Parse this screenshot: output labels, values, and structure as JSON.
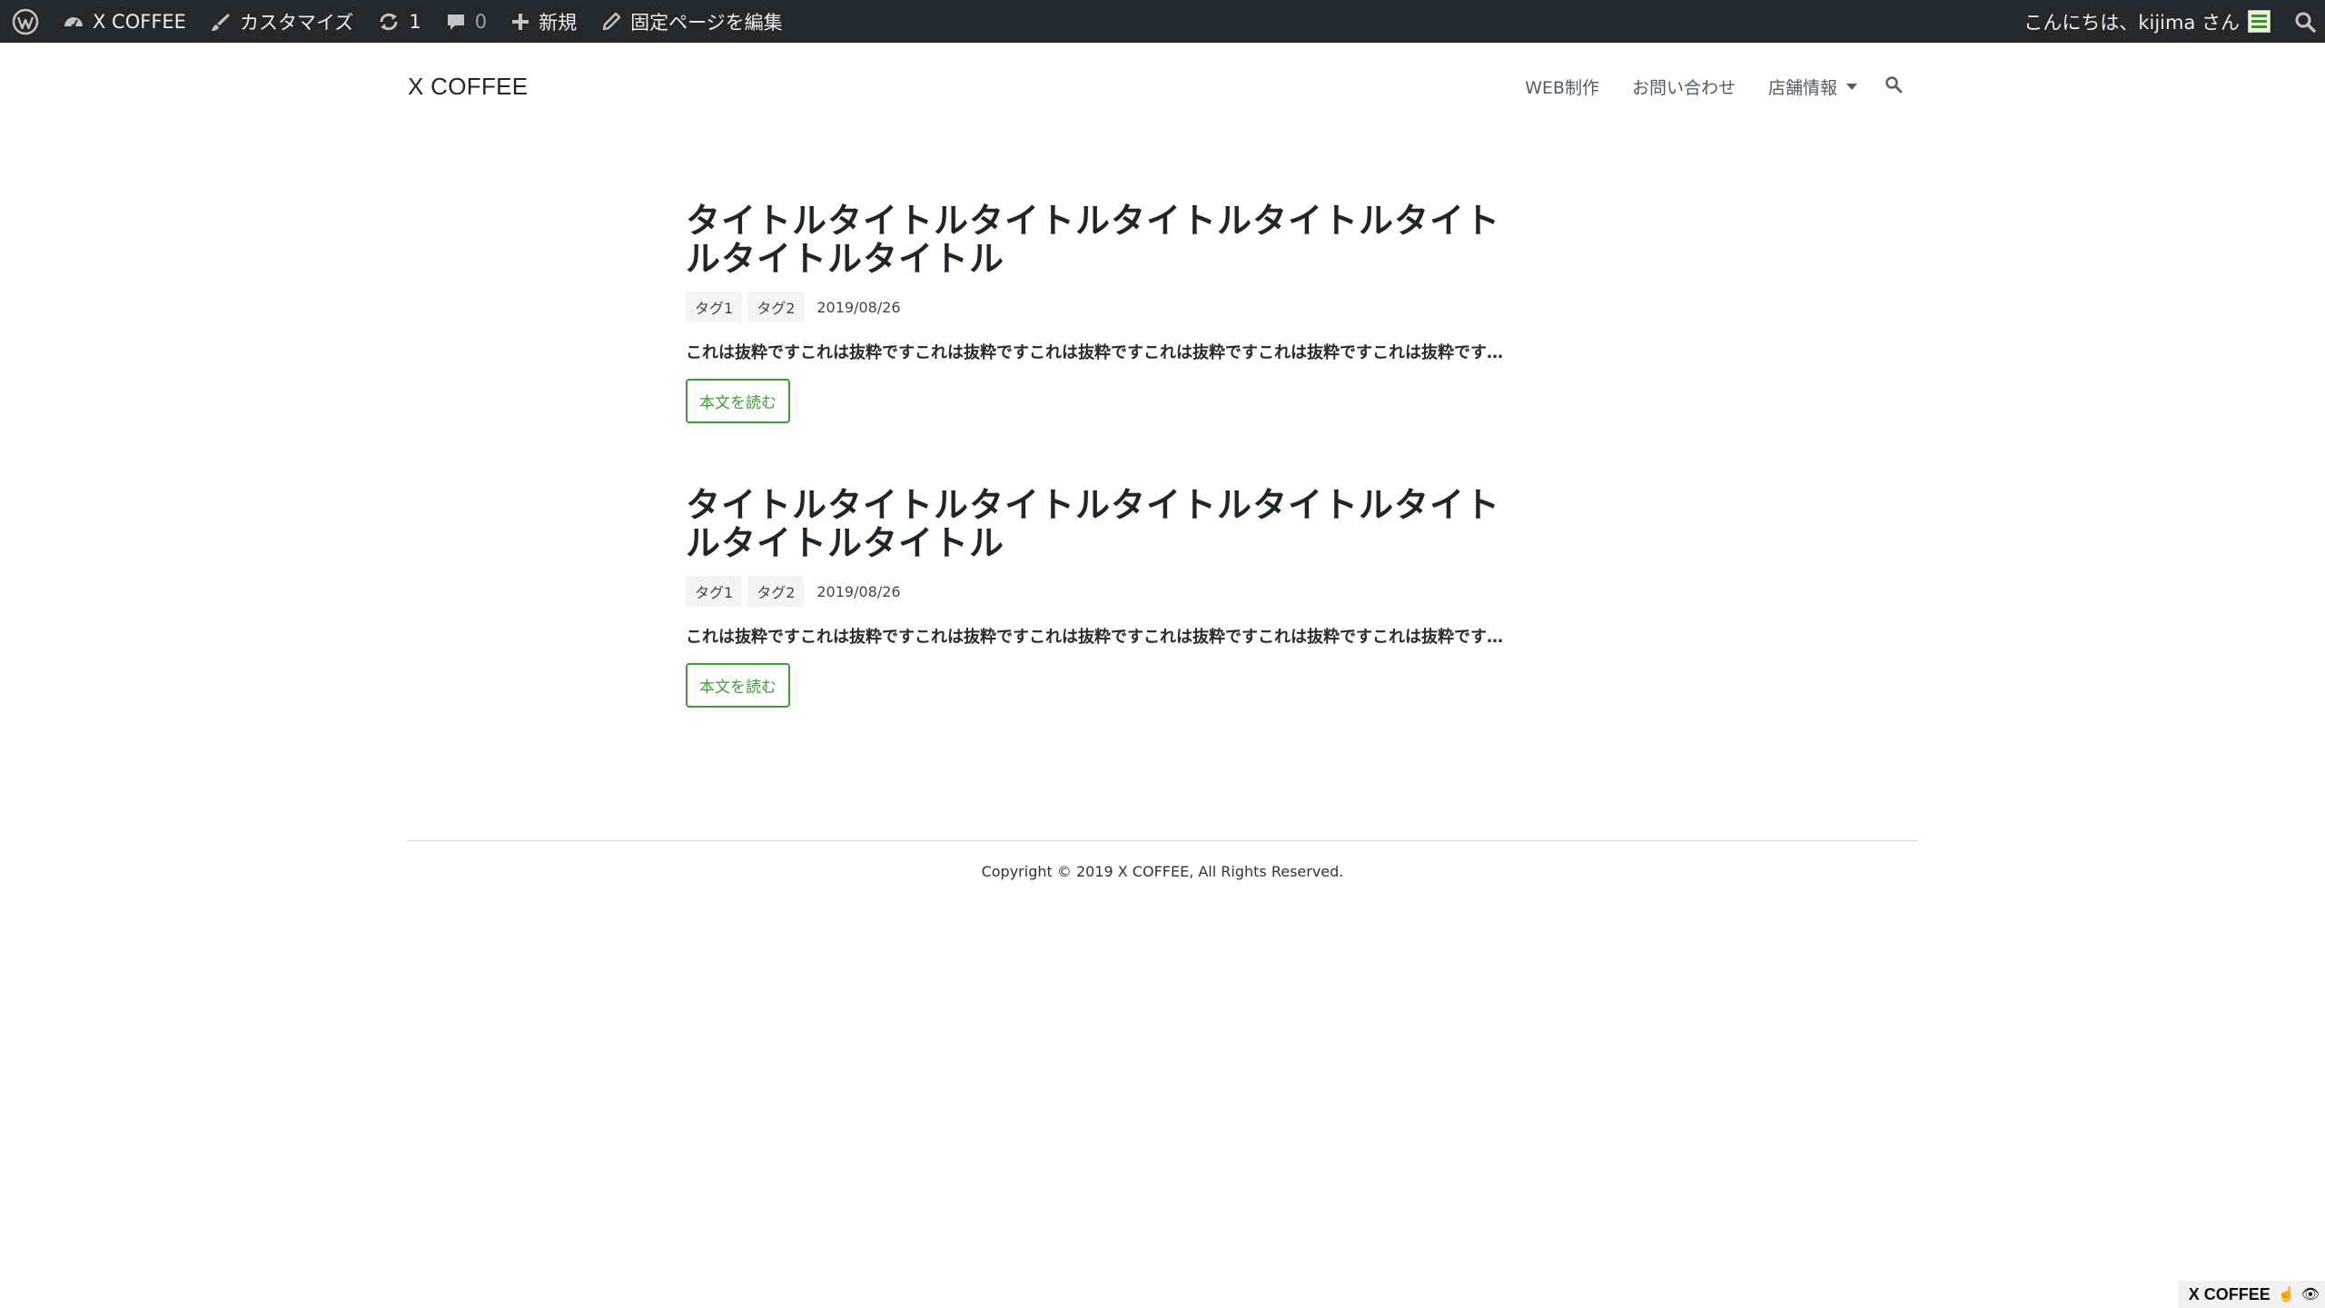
{
  "adminbar": {
    "wp_logo": "wordpress-logo-icon",
    "site_name": "X COFFEE",
    "customize": "カスタマイズ",
    "updates_count": "1",
    "comments_count": "0",
    "new": "新規",
    "edit_page": "固定ページを編集",
    "greeting": "こんにちは、kijima さん"
  },
  "site": {
    "title": "X COFFEE"
  },
  "nav": {
    "items": [
      {
        "label": "WEB制作"
      },
      {
        "label": "お問い合わせ"
      },
      {
        "label": "店舗情報"
      }
    ]
  },
  "posts": [
    {
      "title": "タイトルタイトルタイトルタイトルタイトルタイトルタイトルタイトル",
      "tags": [
        "タグ1",
        "タグ2"
      ],
      "date": "2019/08/26",
      "excerpt": "これは抜粋ですこれは抜粋ですこれは抜粋ですこれは抜粋ですこれは抜粋ですこれは抜粋ですこれは抜粋です…",
      "button": "本文を読む"
    },
    {
      "title": "タイトルタイトルタイトルタイトルタイトルタイトルタイトルタイトル",
      "tags": [
        "タグ1",
        "タグ2"
      ],
      "date": "2019/08/26",
      "excerpt": "これは抜粋ですこれは抜粋ですこれは抜粋ですこれは抜粋ですこれは抜粋ですこれは抜粋ですこれは抜粋です…",
      "button": "本文を読む"
    }
  ],
  "footer": {
    "copyright": "Copyright © 2019 X COFFEE, All Rights Reserved."
  },
  "badge": {
    "label": "X COFFEE"
  },
  "colors": {
    "adminbar_bg": "#23282d",
    "accent_green": "#3f9b36",
    "text": "#212529"
  }
}
